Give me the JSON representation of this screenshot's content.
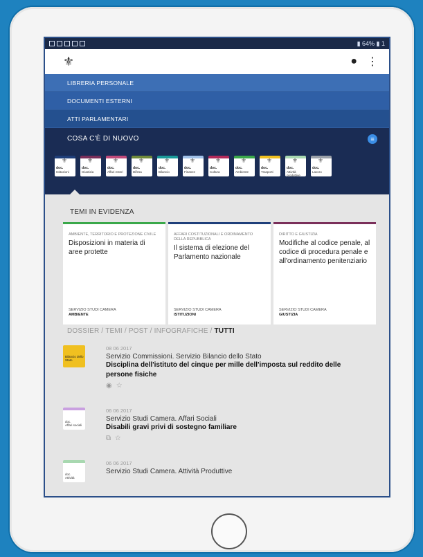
{
  "menu": {
    "libreria": "LIBRERIA PERSONALE",
    "documenti": "DOCUMENTI ESTERNI",
    "atti": "ATTI PARLAMENTARI"
  },
  "status": {
    "battery": "64%"
  },
  "news": {
    "title": "COSA C'È DI NUOVO"
  },
  "categories": [
    {
      "label": "Istituzioni",
      "color": "#1f3f7a"
    },
    {
      "label": "Giustizia",
      "color": "#7a2f5a"
    },
    {
      "label": "Affari esteri",
      "color": "#c04a7a"
    },
    {
      "label": "Difesa",
      "color": "#6f8a3a"
    },
    {
      "label": "Bilancio",
      "color": "#1a9a9a"
    },
    {
      "label": "Finanze",
      "color": "#9fc0e8"
    },
    {
      "label": "Cultura",
      "color": "#b22a5a"
    },
    {
      "label": "Ambiente",
      "color": "#3aa84a"
    },
    {
      "label": "Trasporti",
      "color": "#f0c020"
    },
    {
      "label": "Attività produttive",
      "color": "#a8d8b0"
    },
    {
      "label": "Lavoro",
      "color": "#9aa0a8"
    }
  ],
  "featured": {
    "title": "TEMI IN EVIDENZA",
    "cards": [
      {
        "topic": "AMBIENTE, TERRITORIO E PROTEZIONE CIVILE",
        "title": "Disposizioni in materia di aree protette",
        "src": "SERVIZIO STUDI CAMERA",
        "area": "AMBIENTE",
        "color": "#3aa84a"
      },
      {
        "topic": "AFFARI COSTITUZIONALI E ORDINAMENTO DELLA REPUBBLICA",
        "title": "Il sistema di elezione del Parlamento nazionale",
        "src": "SERVIZIO STUDI CAMERA",
        "area": "ISTITUZIONI",
        "color": "#1f3f7a"
      },
      {
        "topic": "DIRITTO E GIUSTIZIA",
        "title": "Modifiche al codice penale, al codice di procedura penale e all'ordinamento penitenziario",
        "src": "SERVIZIO STUDI CAMERA",
        "area": "GIUSTIZIA",
        "color": "#7a2f5a"
      }
    ]
  },
  "filters": {
    "dossier": "DOSSIER",
    "temi": "TEMI",
    "post": "POST",
    "infografiche": "INFOGRAFICHE",
    "tutti": "TUTTI"
  },
  "items": [
    {
      "date": "08 06 2017",
      "org": "Servizio Commissioni. Servizio Bilancio dello Stato",
      "title": "Disciplina dell'istituto del cinque per mille dell'imposta sul reddito delle persone fisiche",
      "thumb": "Bilancio dello Stato"
    },
    {
      "date": "06 06 2017",
      "org": "Servizio Studi Camera. Affari Sociali",
      "title": "Disabili gravi privi di sostegno familiare",
      "thumb": "Affari sociali"
    },
    {
      "date": "06 06 2017",
      "org": "Servizio Studi Camera. Attività Produttive",
      "title": "",
      "thumb": "Attività"
    }
  ]
}
